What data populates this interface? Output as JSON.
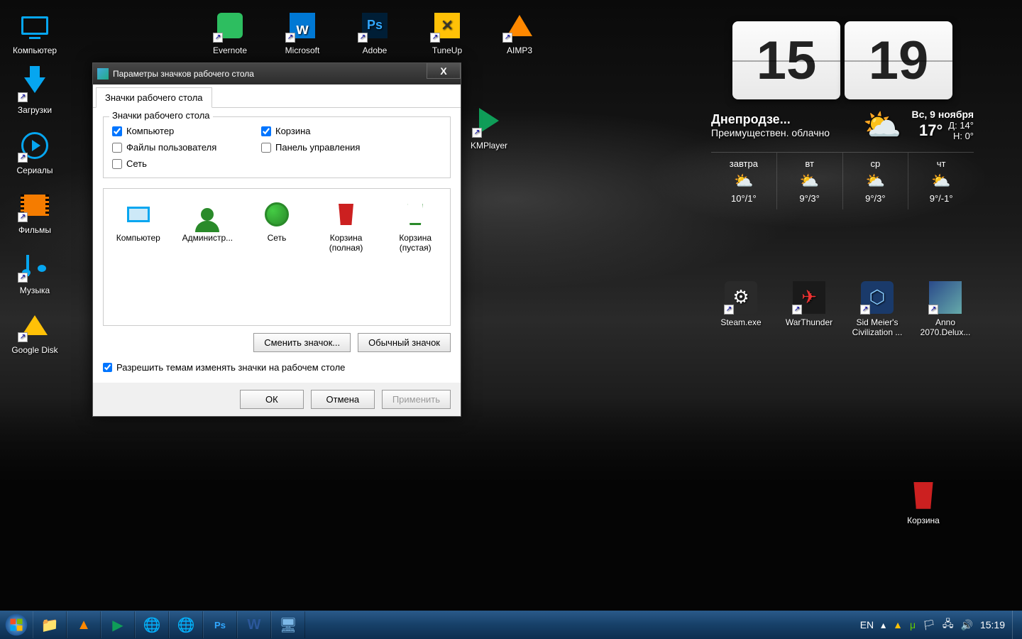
{
  "desktop_icons_left": [
    {
      "name": "computer",
      "label": "Компьютер"
    },
    {
      "name": "downloads",
      "label": "Загрузки"
    },
    {
      "name": "serials",
      "label": "Сериалы"
    },
    {
      "name": "movies",
      "label": "Фильмы"
    },
    {
      "name": "music",
      "label": "Музыка"
    },
    {
      "name": "google-disk",
      "label": "Google Disk"
    }
  ],
  "desktop_icons_top": [
    {
      "name": "evernote",
      "label": "Evernote"
    },
    {
      "name": "microsoft",
      "label": "Microsoft"
    },
    {
      "name": "adobe",
      "label": "Adobe"
    },
    {
      "name": "tuneup",
      "label": "TuneUp"
    },
    {
      "name": "aimp3",
      "label": "AIMP3"
    }
  ],
  "kmplayer_label": "KMPlayer",
  "desktop_icons_right": [
    {
      "name": "steam",
      "label": "Steam.exe"
    },
    {
      "name": "warthunder",
      "label": "WarThunder"
    },
    {
      "name": "civilization",
      "label": "Sid Meier's Civilization ..."
    },
    {
      "name": "anno",
      "label": "Anno 2070.Delux..."
    }
  ],
  "recycle_label": "Корзина",
  "dialog": {
    "title": "Параметры значков рабочего стола",
    "tab": "Значки рабочего стола",
    "group": "Значки рабочего стола",
    "checks": {
      "computer": "Компьютер",
      "recycle": "Корзина",
      "userfiles": "Файлы пользователя",
      "cpanel": "Панель управления",
      "network": "Сеть"
    },
    "icons": [
      {
        "label": "Компьютер"
      },
      {
        "label": "Администр..."
      },
      {
        "label": "Сеть"
      },
      {
        "label": "Корзина (полная)"
      },
      {
        "label": "Корзина (пустая)"
      }
    ],
    "change": "Сменить значок...",
    "default": "Обычный значок",
    "allow": "Разрешить темам изменять значки на рабочем столе",
    "ok": "ОК",
    "cancel": "Отмена",
    "apply": "Применить"
  },
  "widget": {
    "hours": "15",
    "minutes": "19",
    "location": "Днепродзе...",
    "condition": "Преимуществен. облачно",
    "date": "Вс, 9 ноября",
    "temp": "17°",
    "high_label": "Д:",
    "high": "14°",
    "low_label": "Н:",
    "low": "0°",
    "forecast": [
      {
        "day": "завтра",
        "temp": "10°/1°"
      },
      {
        "day": "вт",
        "temp": "9°/3°"
      },
      {
        "day": "ср",
        "temp": "9°/3°"
      },
      {
        "day": "чт",
        "temp": "9°/-1°"
      }
    ]
  },
  "taskbar": {
    "lang": "EN",
    "time": "15:19"
  }
}
